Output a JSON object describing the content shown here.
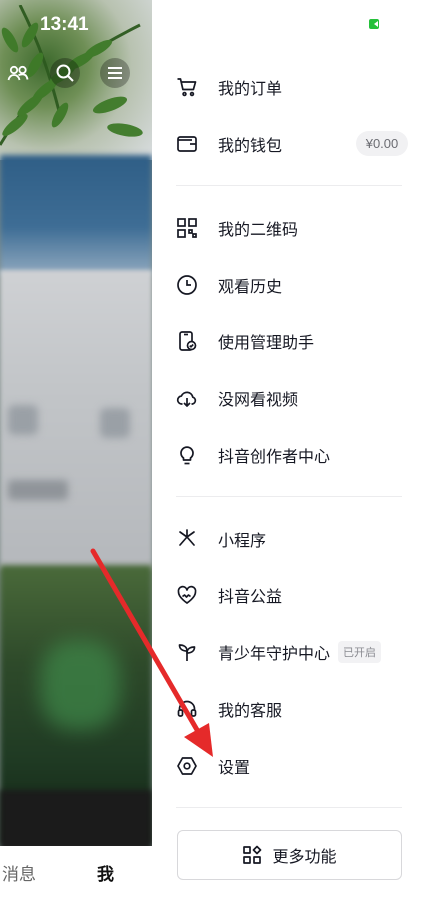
{
  "status": {
    "time": "13:41"
  },
  "menu": {
    "orders": "我的订单",
    "wallet": "我的钱包",
    "wallet_balance": "¥0.00",
    "qrcode": "我的二维码",
    "history": "观看历史",
    "manage": "使用管理助手",
    "offline": "没网看视频",
    "creator": "抖音创作者中心",
    "miniapp": "小程序",
    "charity": "抖音公益",
    "youth": "青少年守护中心",
    "youth_badge": "已开启",
    "service": "我的客服",
    "settings": "设置",
    "more": "更多功能"
  },
  "tabs": {
    "messages": "消息",
    "me": "我"
  },
  "colors": {
    "arrow": "#e52a2a",
    "battery": "#25c13a",
    "text": "#161823"
  }
}
